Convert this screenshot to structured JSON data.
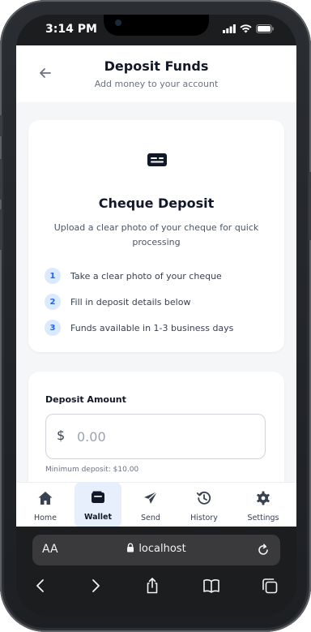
{
  "status_bar": {
    "time": "3:14 PM"
  },
  "header": {
    "title": "Deposit Funds",
    "subtitle": "Add money to your account",
    "back_icon": "arrow-left-icon"
  },
  "info_card": {
    "icon": "cheque-card-icon",
    "title": "Cheque Deposit",
    "description": "Upload a clear photo of your cheque for quick processing",
    "steps": [
      {
        "num": "1",
        "text": "Take a clear photo of your cheque"
      },
      {
        "num": "2",
        "text": "Fill in deposit details below"
      },
      {
        "num": "3",
        "text": "Funds available in 1-3 business days"
      }
    ]
  },
  "amount_card": {
    "label": "Deposit Amount",
    "currency": "$",
    "value": "",
    "placeholder": "0.00",
    "minimum": "Minimum deposit: $10.00"
  },
  "bottom_nav": {
    "items": [
      {
        "label": "Home",
        "icon": "home-icon",
        "active": false
      },
      {
        "label": "Wallet",
        "icon": "wallet-icon",
        "active": true
      },
      {
        "label": "Send",
        "icon": "send-icon",
        "active": false
      },
      {
        "label": "History",
        "icon": "history-icon",
        "active": false
      },
      {
        "label": "Settings",
        "icon": "gear-icon",
        "active": false
      }
    ]
  },
  "browser": {
    "text_size_label": "AA",
    "url": "localhost"
  },
  "colors": {
    "accent": "#2563eb",
    "accent_light": "#dbeafe",
    "active_nav_bg": "#e8effc",
    "page_bg": "#f5f6f8"
  }
}
